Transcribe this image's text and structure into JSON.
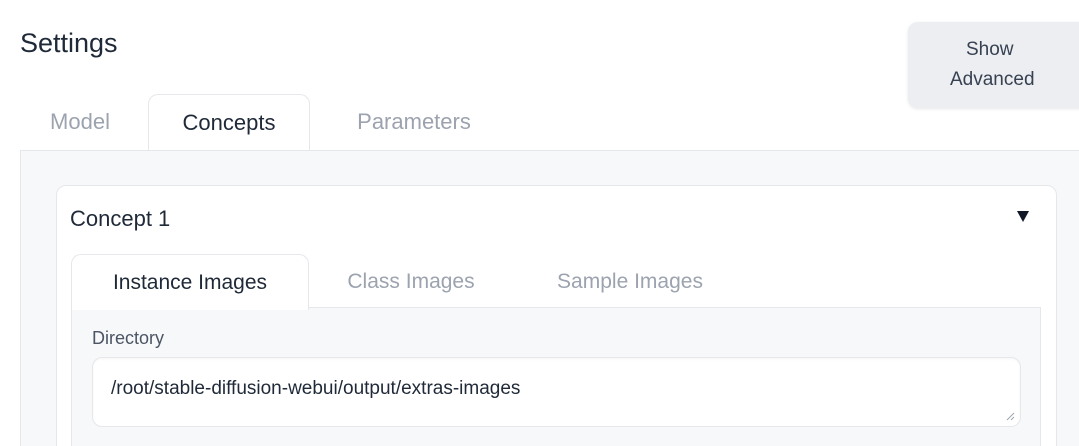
{
  "header": {
    "title": "Settings",
    "advanced_button": {
      "line1": "Show",
      "line2": "Advanced"
    }
  },
  "tabs": [
    {
      "label": "Model",
      "active": false
    },
    {
      "label": "Concepts",
      "active": true
    },
    {
      "label": "Parameters",
      "active": false
    }
  ],
  "concept": {
    "title": "Concept 1",
    "collapse_icon": "triangle-down-icon",
    "tabs": [
      {
        "label": "Instance Images",
        "active": true
      },
      {
        "label": "Class Images",
        "active": false
      },
      {
        "label": "Sample Images",
        "active": false
      }
    ],
    "directory": {
      "label": "Directory",
      "value": "/root/stable-diffusion-webui/output/extras-images"
    }
  }
}
